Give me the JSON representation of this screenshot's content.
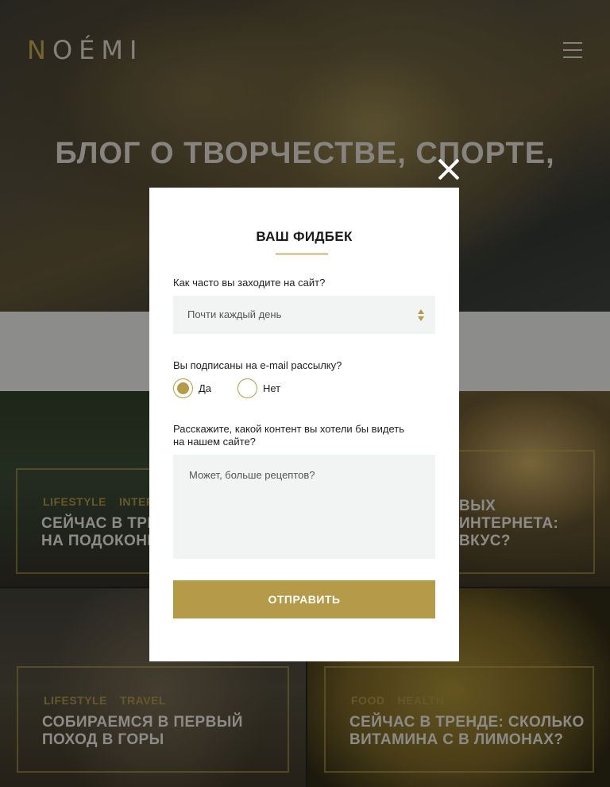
{
  "header": {
    "logo_accent": "N",
    "logo_rest": "OÉMI",
    "menu_icon": "hamburger-menu-icon"
  },
  "hero": {
    "title": "БЛОГ О ТВОРЧЕСТВЕ, СПОРТЕ,"
  },
  "cards": [
    {
      "tags": [
        "LIFESTYLE",
        "INTERIO"
      ],
      "title_line1": "СЕЙЧАС В ТРЕНД",
      "title_line2": "НА ПОДОКОНН"
    },
    {
      "tags": [],
      "title_line0": "ВЫХ",
      "title_line1": "ИНТЕРНЕТА:",
      "title_line2": "ВКУС?"
    },
    {
      "tags": [
        "LIFESTYLE",
        "TRAVEL"
      ],
      "title_line1": "СОБИРАЕМСЯ В ПЕРВЫЙ",
      "title_line2": "ПОХОД В ГОРЫ"
    },
    {
      "tags": [
        "FOOD",
        "HEALTH"
      ],
      "title_line1": "СЕЙЧАС В ТРЕНДЕ: СКОЛЬКО",
      "title_line2": "ВИТАМИНА С В ЛИМОНАХ?"
    }
  ],
  "modal": {
    "title": "ВАШ ФИДБЕК",
    "q1_label": "Как часто вы заходите на сайт?",
    "q1_value": "Почти каждый день",
    "q2_label": "Вы подписаны на e-mail рассылку?",
    "q2_options": [
      "Да",
      "Нет"
    ],
    "q2_selected": "Да",
    "q3_label_line1": "Расскажите, какой контент вы хотели бы видеть",
    "q3_label_line2": "на нашем сайте?",
    "q3_placeholder": "Может, больше рецептов?",
    "submit_label": "ОТПРАВИТЬ",
    "close_icon": "close-icon"
  },
  "colors": {
    "accent": "#b59a4a",
    "field_bg": "#f2f4f3",
    "overlay": "rgba(0,0,0,0.35)"
  }
}
